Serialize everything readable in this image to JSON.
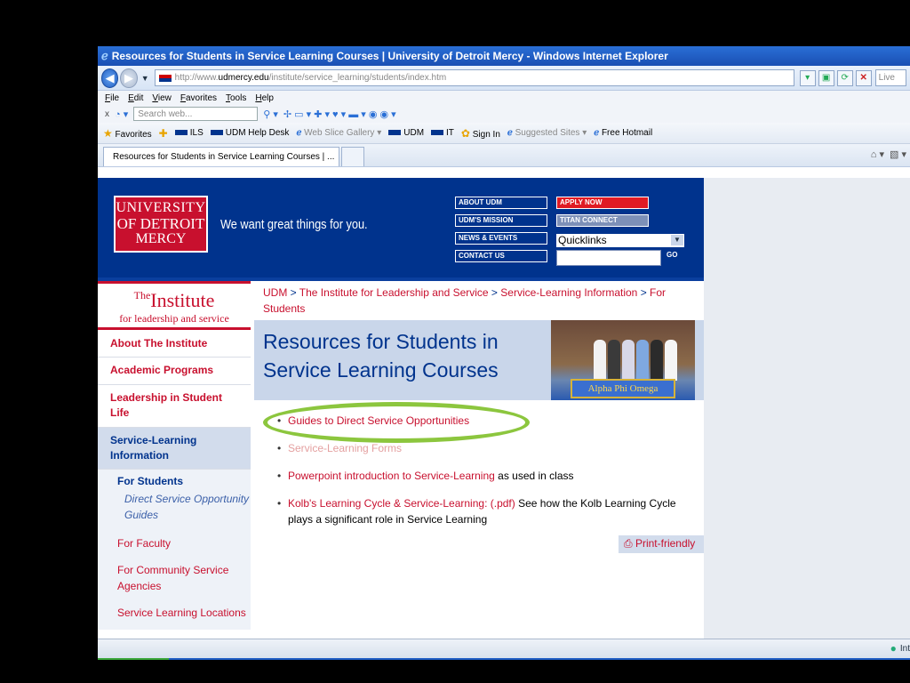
{
  "window": {
    "title": "Resources for Students in Service Learning Courses | University of Detroit Mercy - Windows Internet Explorer"
  },
  "address": {
    "url_prefix": "http://www.",
    "url_host": "udmercy.edu",
    "url_path": "/institute/service_learning/students/index.htm",
    "live_search_placeholder": "Live"
  },
  "menu": [
    "File",
    "Edit",
    "View",
    "Favorites",
    "Tools",
    "Help"
  ],
  "search_toolbar": {
    "close": "x",
    "placeholder": "Search web..."
  },
  "favorites_bar": {
    "favorites": "Favorites",
    "items": [
      "ILS",
      "UDM Help Desk",
      "Web Slice Gallery",
      "UDM",
      "IT",
      "Sign In",
      "Suggested Sites",
      "Free Hotmail"
    ]
  },
  "tabs": [
    {
      "label": "Resources for Students in Service Learning Courses | ..."
    }
  ],
  "site": {
    "logo": {
      "line1": "UNIVERSITY",
      "line2": "OF DETROIT",
      "line3": "MERCY"
    },
    "tagline": "We want great things for you.",
    "header_links": {
      "about": "ABOUT UDM",
      "mission": "UDM'S MISSION",
      "news": "NEWS & EVENTS",
      "contact": "CONTACT US",
      "apply": "APPLY NOW",
      "titan": "TITAN CONNECT"
    },
    "quicklinks": "Quicklinks",
    "go": "GO"
  },
  "sidebar": {
    "institute_the": "The",
    "institute_name": "Institute",
    "institute_sub": "for leadership and service",
    "nav": [
      "About The Institute",
      "Academic Programs",
      "Leadership in Student Life",
      "Service-Learning Information"
    ],
    "sub_current": "For Students",
    "sub_current_child": "Direct Service Opportunity Guides",
    "sub_links": [
      "For Faculty",
      "For Community Service Agencies",
      "Service Learning Locations"
    ]
  },
  "main": {
    "breadcrumb": [
      "UDM",
      "The Institute for Leadership and Service",
      "Service-Learning Information",
      "For Students"
    ],
    "breadcrumb_sep": " > ",
    "title": "Resources for Students in Service Learning Courses",
    "photo_banner": "Alpha Phi Omega",
    "items": [
      {
        "link": "Guides to Direct Service Opportunities",
        "text": ""
      },
      {
        "link": "Service-Learning Forms",
        "text": ""
      },
      {
        "link": "Powerpoint introduction to Service-Learning",
        "text": " as used in class"
      },
      {
        "link": "Kolb's Learning Cycle & Service-Learning: (.pdf)",
        "text": " See how the Kolb Learning Cycle plays a significant role in Service Learning"
      }
    ],
    "print": "Print-friendly"
  },
  "status": {
    "zone": "Int"
  },
  "colors": {
    "udm_blue": "#00338d",
    "udm_red": "#c8102e",
    "highlight_oval": "#8cc63e"
  }
}
